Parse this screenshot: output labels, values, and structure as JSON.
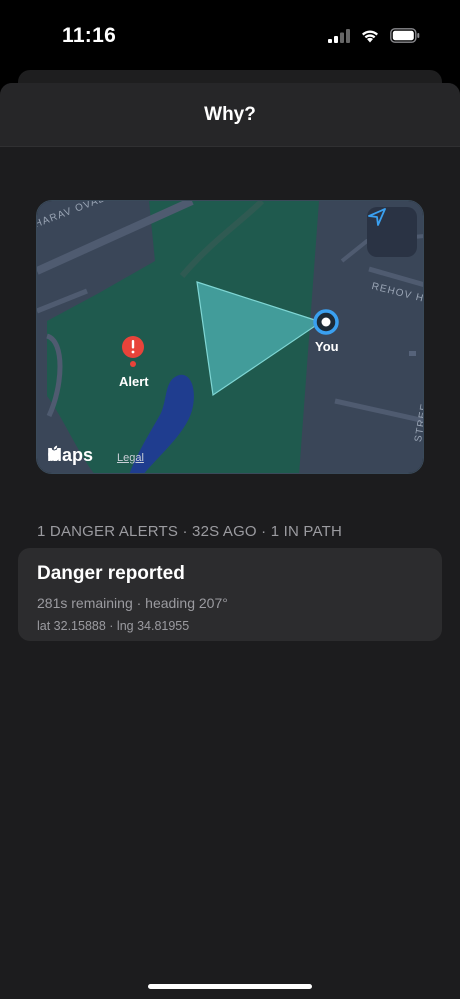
{
  "status_bar": {
    "time": "11:16"
  },
  "sheet": {
    "title": "Why?"
  },
  "map": {
    "street_labels": [
      "HARAV OVADIA YO",
      "REHOV HA",
      "STREE"
    ],
    "alert_label": "Alert",
    "user_label": "You",
    "maps_brand": "Maps",
    "legal_label": "Legal"
  },
  "alerts": {
    "summary": "1 DANGER ALERTS · 32S AGO · 1 IN PATH",
    "items": [
      {
        "title": "Danger reported",
        "detail": "281s remaining · heading 207°",
        "coords": "lat 32.15888 · lng 34.81955"
      }
    ]
  },
  "colors": {
    "sheet_bg": "#1c1c1e",
    "card_bg": "#2c2c2e",
    "map_land": "#3a4658",
    "map_park": "#1f5a4e",
    "map_water": "#1f3d8f",
    "path_cone": "#4fb3b4",
    "alert_red": "#e8433a",
    "user_blue": "#3aa0f0"
  }
}
